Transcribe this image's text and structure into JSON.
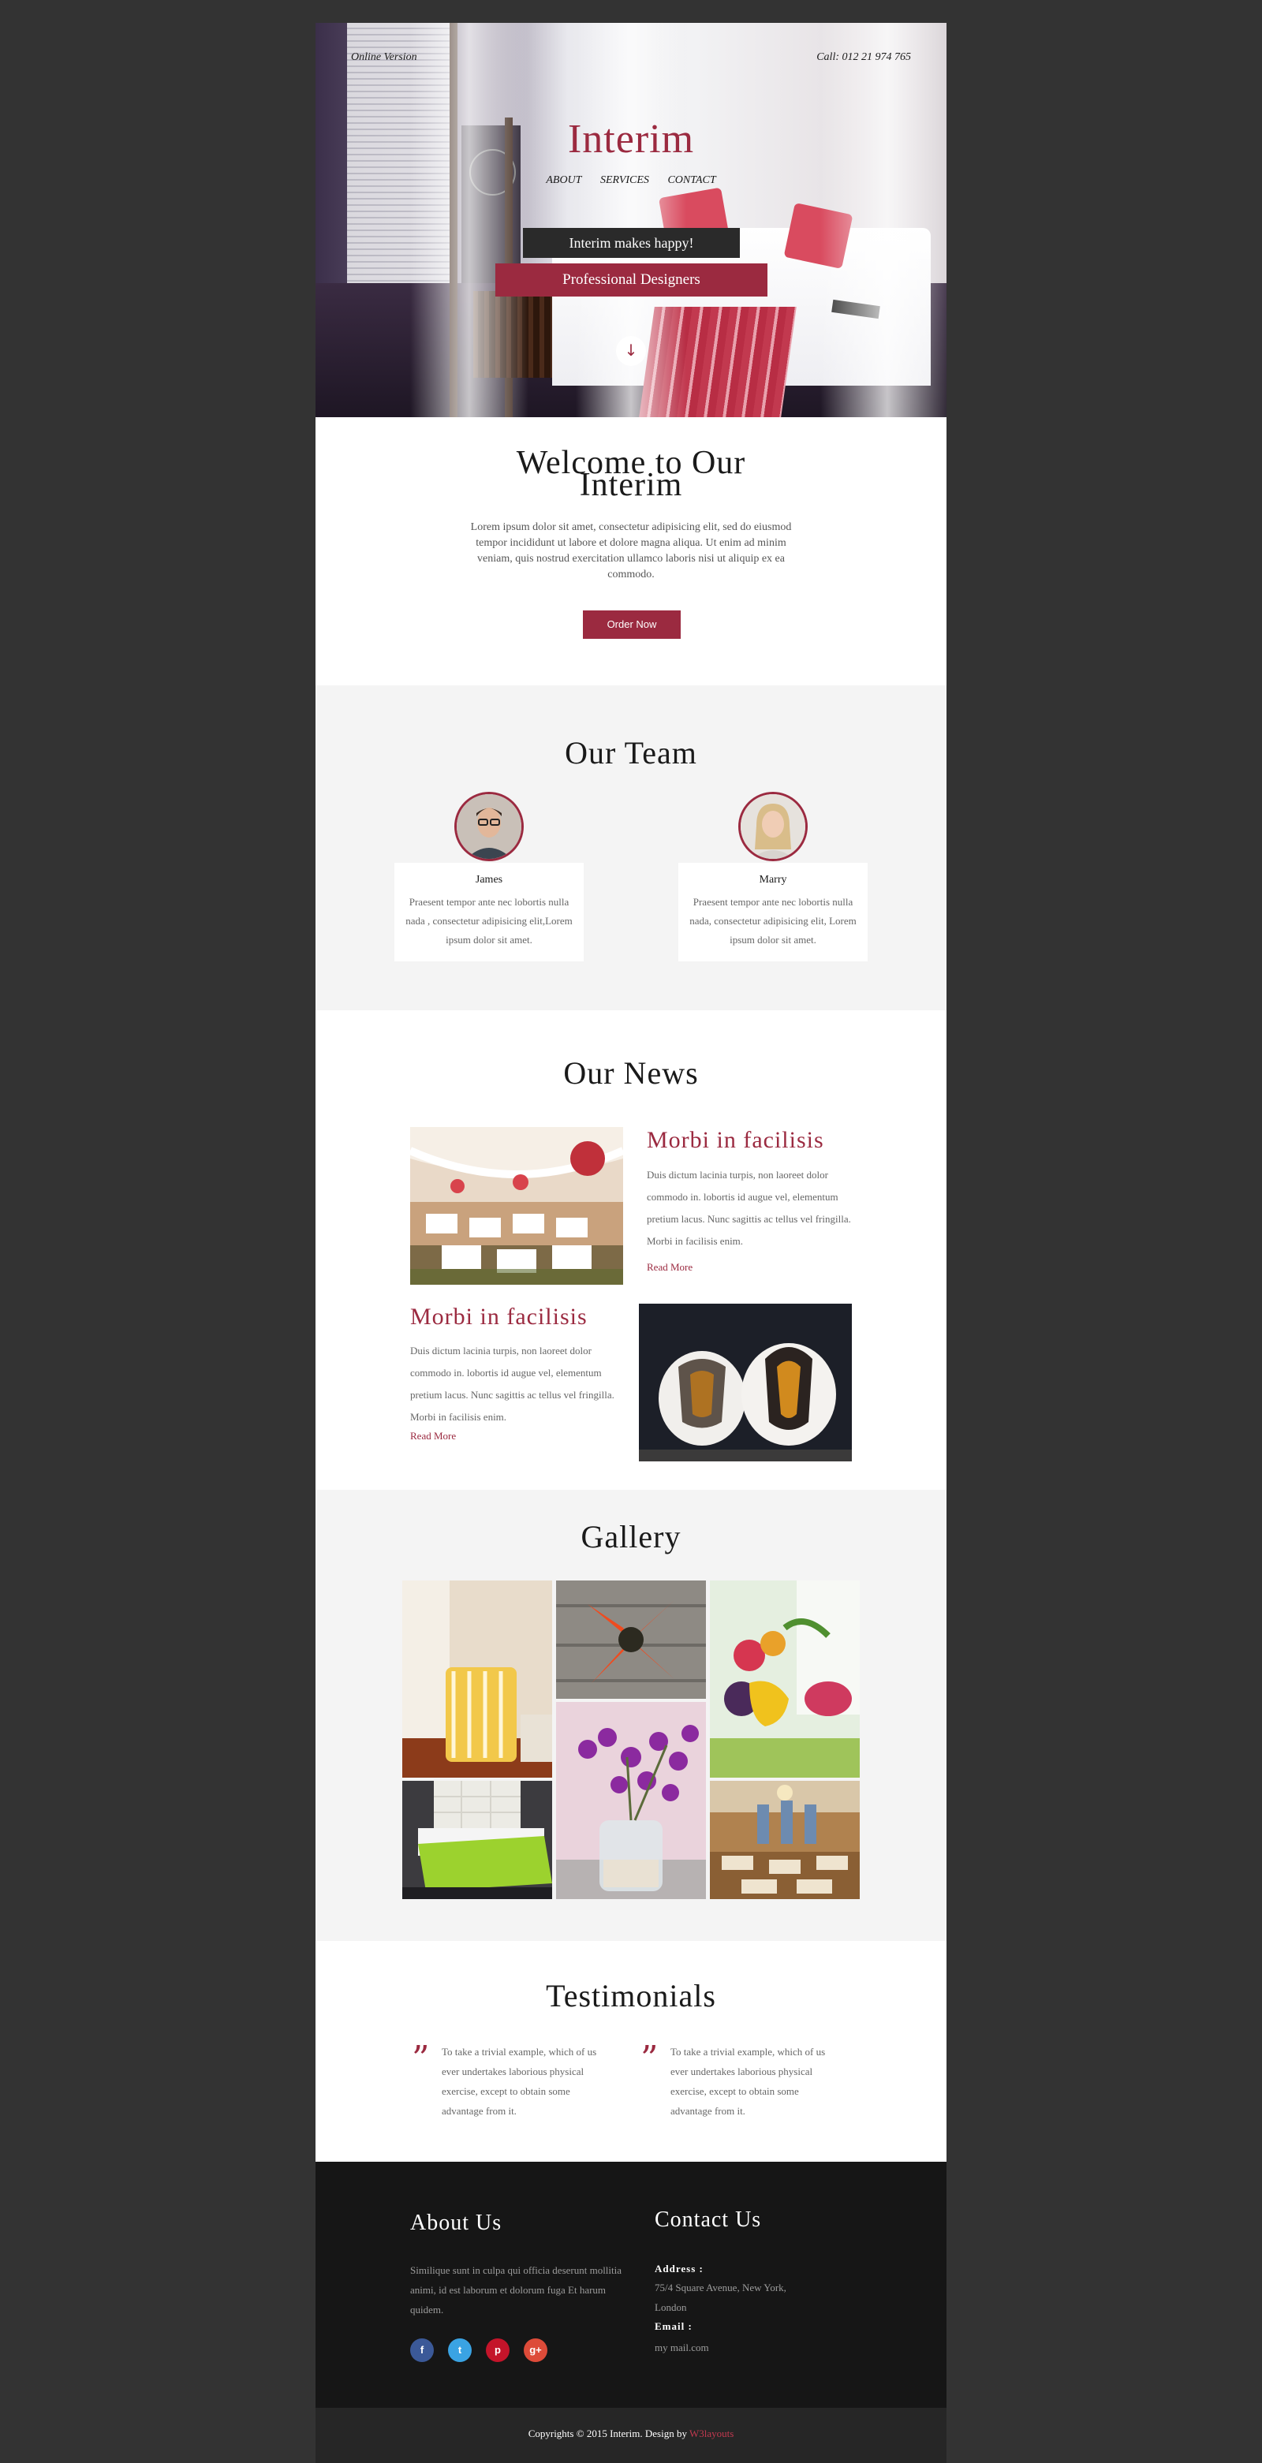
{
  "hero": {
    "online_version": "Online Version",
    "call": "Call: 012 21 974 765",
    "brand": "Interim",
    "nav": [
      "ABOUT",
      "SERVICES",
      "CONTACT"
    ],
    "tagline": "Interim makes happy!",
    "subtagline": "Professional Designers",
    "scroll_icon": "arrow-down-icon"
  },
  "welcome": {
    "title": "Welcome to Our Interim",
    "text": "Lorem ipsum dolor sit amet, consectetur adipisicing elit, sed do eiusmod tempor incididunt ut labore et dolore magna aliqua. Ut enim ad minim veniam, quis nostrud exercitation ullamco laboris nisi ut aliquip ex ea commodo.",
    "button": "Order Now"
  },
  "team": {
    "title": "Our Team",
    "members": [
      {
        "name": "James",
        "desc": "Praesent tempor ante nec lobortis nulla nada , consectetur adipisicing elit,Lorem ipsum dolor sit amet."
      },
      {
        "name": "Marry",
        "desc": "Praesent tempor ante nec lobortis nulla nada, consectetur adipisicing elit, Lorem ipsum dolor sit amet."
      }
    ]
  },
  "news": {
    "title": "Our News",
    "items": [
      {
        "heading": "Morbi in facilisis",
        "text": "Duis dictum lacinia turpis, non laoreet dolor commodo in. lobortis id augue vel, elementum pretium lacus. Nunc sagittis ac tellus vel fringilla. Morbi in facilisis enim.",
        "link": "Read More"
      },
      {
        "heading": "Morbi in facilisis",
        "text": "Duis dictum lacinia turpis, non laoreet dolor commodo in. lobortis id augue vel, elementum pretium lacus. Nunc sagittis ac tellus vel fringilla. Morbi in facilisis enim.",
        "link": "Read More"
      }
    ]
  },
  "gallery": {
    "title": "Gallery"
  },
  "testimonials": {
    "title": "Testimonials",
    "quotes": [
      "To take a trivial example, which of us ever undertakes laborious physical exercise, except to obtain some advantage from it.",
      "To take a trivial example, which of us ever undertakes laborious physical exercise, except to obtain some advantage from it."
    ]
  },
  "footer": {
    "about_title": "About Us",
    "about_text": "Similique sunt in culpa qui officia deserunt mollitia animi, id est laborum et dolorum fuga Et harum quidem.",
    "social": [
      "f",
      "t",
      "p",
      "g+"
    ],
    "contact_title": "Contact Us",
    "address_label": "Address :",
    "address": "75/4 Square Avenue, New York, London",
    "address_line1": "75/4 Square Avenue, New York,",
    "address_line2": "London",
    "email_label": "Email :",
    "email": "my mail.com",
    "copyright": "Copyrights © 2015 Interim. Design by ",
    "designer": "W3layouts"
  },
  "colors": {
    "accent": "#9b2a40",
    "background": "#333333",
    "footer": "#161616"
  }
}
